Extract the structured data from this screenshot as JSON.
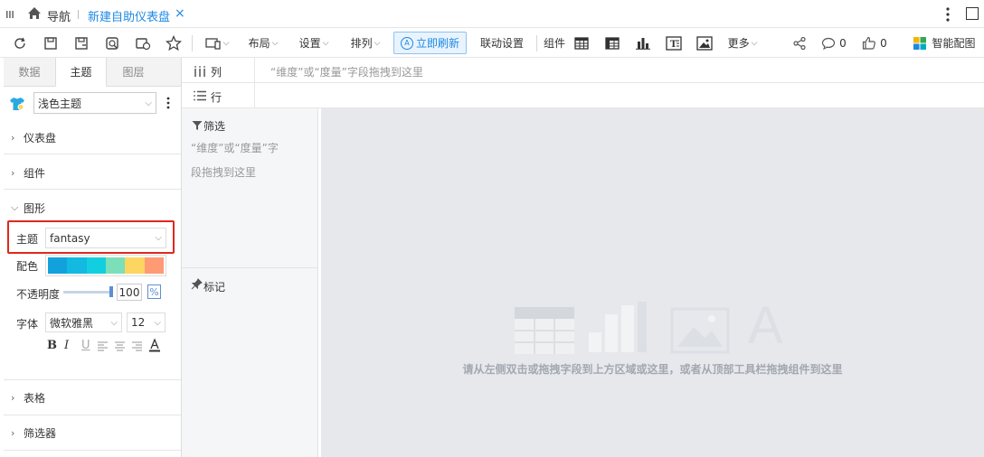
{
  "titlebar": {
    "menu_icon": "hamburger-icon",
    "nav_label": "导航",
    "tab_label": "新建自助仪表盘",
    "close_char": "×"
  },
  "toolbar": {
    "layout_label": "布局",
    "settings_label": "设置",
    "arrange_label": "排列",
    "refresh_label": "立即刷新",
    "linkage_label": "联动设置",
    "components_label": "组件",
    "more_label": "更多",
    "comments_count": "0",
    "likes_count": "0",
    "smart_label": "智能配图"
  },
  "left": {
    "tabs": [
      "数据",
      "主题",
      "图层"
    ],
    "theme_select": "浅色主题",
    "sections": {
      "dashboard": "仪表盘",
      "component": "组件",
      "graphics": "图形",
      "table": "表格",
      "filter": "筛选器"
    },
    "theme_label": "主题",
    "theme_value": "fantasy",
    "colors_label": "配色",
    "palette": [
      "#12a1dc",
      "#12b9e1",
      "#12cfe0",
      "#7ddfb8",
      "#fdd561",
      "#fe9b75"
    ],
    "opacity_label": "不透明度",
    "opacity_value": "100",
    "opacity_unit": "%",
    "font_label": "字体",
    "font_family": "微软雅黑",
    "font_size": "12",
    "format_buttons": [
      "B",
      "I",
      "U"
    ]
  },
  "fields": {
    "columns_label": "列",
    "columns_hint": "“维度”或“度量”字段拖拽到这里",
    "rows_label": "行"
  },
  "middle": {
    "filter_label": "筛选",
    "filter_hint_1": "“维度”或“度量”字",
    "filter_hint_2": "段拖拽到这里",
    "marks_label": "标记"
  },
  "canvas": {
    "placeholder_text": "请从左侧双击或拖拽字段到上方区域或这里，或者从顶部工具栏拖拽组件到这里"
  },
  "colors": {
    "accent": "#1e88e5",
    "highlight_border": "#e0281e",
    "canvas_bg": "#e6e8ec"
  }
}
